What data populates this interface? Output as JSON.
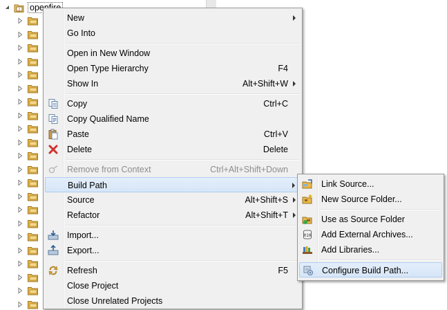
{
  "tree": {
    "project_name": "openfire",
    "project_icon": "java-project-icon",
    "package_icon": "package-folder-icon",
    "collapsed_rows": 22
  },
  "context_menu": {
    "items": [
      {
        "label": "New",
        "shortcut": "",
        "submenu": true,
        "icon": ""
      },
      {
        "label": "Go Into",
        "shortcut": "",
        "submenu": false,
        "icon": ""
      },
      {
        "label": "Open in New Window",
        "shortcut": "",
        "submenu": false,
        "icon": ""
      },
      {
        "label": "Open Type Hierarchy",
        "shortcut": "F4",
        "submenu": false,
        "icon": ""
      },
      {
        "label": "Show In",
        "shortcut": "Alt+Shift+W",
        "submenu": true,
        "icon": ""
      },
      {
        "label": "Copy",
        "shortcut": "Ctrl+C",
        "submenu": false,
        "icon": "copy-icon"
      },
      {
        "label": "Copy Qualified Name",
        "shortcut": "",
        "submenu": false,
        "icon": "copy-qualified-name-icon"
      },
      {
        "label": "Paste",
        "shortcut": "Ctrl+V",
        "submenu": false,
        "icon": "paste-icon"
      },
      {
        "label": "Delete",
        "shortcut": "Delete",
        "submenu": false,
        "icon": "delete-icon"
      },
      {
        "label": "Remove from Context",
        "shortcut": "Ctrl+Alt+Shift+Down",
        "submenu": false,
        "icon": "remove-from-context-icon",
        "disabled": true
      },
      {
        "label": "Build Path",
        "shortcut": "",
        "submenu": true,
        "icon": "",
        "highlighted": true
      },
      {
        "label": "Source",
        "shortcut": "Alt+Shift+S",
        "submenu": true,
        "icon": ""
      },
      {
        "label": "Refactor",
        "shortcut": "Alt+Shift+T",
        "submenu": true,
        "icon": ""
      },
      {
        "label": "Import...",
        "shortcut": "",
        "submenu": false,
        "icon": "import-icon"
      },
      {
        "label": "Export...",
        "shortcut": "",
        "submenu": false,
        "icon": "export-icon"
      },
      {
        "label": "Refresh",
        "shortcut": "F5",
        "submenu": false,
        "icon": "refresh-icon"
      },
      {
        "label": "Close Project",
        "shortcut": "",
        "submenu": false,
        "icon": ""
      },
      {
        "label": "Close Unrelated Projects",
        "shortcut": "",
        "submenu": false,
        "icon": ""
      }
    ]
  },
  "build_path_submenu": {
    "items": [
      {
        "label": "Link Source...",
        "icon": "link-source-icon"
      },
      {
        "label": "New Source Folder...",
        "icon": "new-source-folder-icon"
      },
      {
        "label": "Use as Source Folder",
        "icon": "use-as-source-folder-icon"
      },
      {
        "label": "Add External Archives...",
        "icon": "add-external-archives-icon"
      },
      {
        "label": "Add Libraries...",
        "icon": "add-libraries-icon"
      },
      {
        "label": "Configure Build Path...",
        "icon": "configure-build-path-icon",
        "highlighted": true
      }
    ]
  },
  "colors": {
    "menu_background": "#f0f0f0",
    "highlight_background": "#dbe8f9",
    "highlight_border": "#aeccf0",
    "disabled_text": "#8d8d8d",
    "package_folder": "#e8b84a"
  }
}
